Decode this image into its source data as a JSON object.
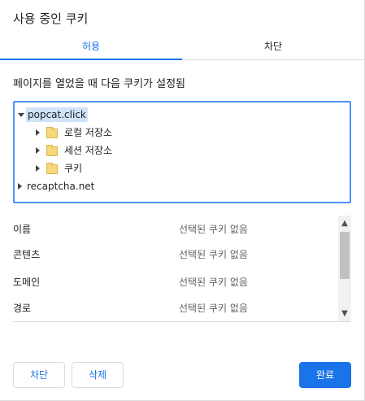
{
  "dialog": {
    "title": "사용 중인 쿠키",
    "tabs": [
      {
        "label": "허용",
        "active": true
      },
      {
        "label": "차단",
        "active": false
      }
    ],
    "subtitle": "페이지를 열었을 때 다음 쿠키가 설정됨"
  },
  "tree": {
    "root": {
      "label": "popcat.click",
      "expanded": true,
      "selected": true
    },
    "children": [
      {
        "label": "로컬 저장소",
        "icon": "folder-icon"
      },
      {
        "label": "세션 저장소",
        "icon": "folder-icon"
      },
      {
        "label": "쿠키",
        "icon": "folder-icon"
      }
    ],
    "other": {
      "label": "recaptcha.net",
      "expanded": false
    }
  },
  "details": {
    "rows": [
      {
        "key": "이름",
        "value": "선택된 쿠키 없음"
      },
      {
        "key": "콘텐츠",
        "value": "선택된 쿠키 없음"
      },
      {
        "key": "도메인",
        "value": "선택된 쿠키 없음"
      },
      {
        "key": "경로",
        "value": "선택된 쿠키 없음"
      }
    ]
  },
  "buttons": {
    "block": "차단",
    "delete": "삭제",
    "done": "완료"
  },
  "colors": {
    "accent": "#1a73e8",
    "focus_border": "#4d90fe",
    "selection": "#cfe3f9"
  }
}
